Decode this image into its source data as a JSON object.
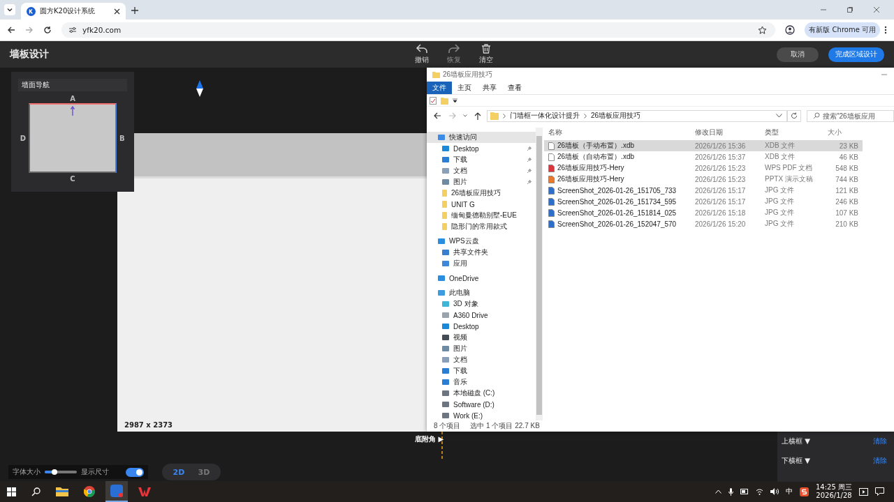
{
  "browser": {
    "tab": {
      "title": "圆方K20设计系统"
    },
    "url": "yfk20.com",
    "update_button": "有新版 Chrome 可用"
  },
  "app": {
    "title": "墙板设计",
    "toolbar": [
      {
        "label": "撤销",
        "kind": "undo",
        "disabled": false
      },
      {
        "label": "恢复",
        "kind": "redo",
        "disabled": true
      },
      {
        "label": "清空",
        "kind": "trash",
        "disabled": false
      }
    ],
    "buttons": [
      {
        "label": "取消",
        "kind": "secondary"
      },
      {
        "label": "完成区域设计",
        "kind": "primary"
      }
    ],
    "wall_nav": {
      "title": "墙面导航",
      "side_a": "A",
      "side_b": "B",
      "side_c": "C",
      "side_d": "D"
    },
    "canvas": {
      "dimensions": "2987 x 2373",
      "corner_label": "底附角 ▶"
    },
    "side_panel": [
      {
        "label": "上横框 ▼",
        "action": "清除"
      },
      {
        "label": "下横框 ▼",
        "action": "清除"
      }
    ],
    "font_size": {
      "label": "字体大小",
      "level": 0.3
    },
    "show_dimensions": {
      "label": "显示尺寸",
      "on": true
    },
    "view_modes": [
      {
        "label": "2D",
        "selected": true
      },
      {
        "label": "3D",
        "selected": false
      }
    ]
  },
  "explorer": {
    "title": "26墙板应用技巧",
    "ribbon_tabs": [
      {
        "label": "文件",
        "selected": true
      },
      {
        "label": "主页",
        "selected": false
      },
      {
        "label": "共享",
        "selected": false
      },
      {
        "label": "查看",
        "selected": false
      }
    ],
    "path": [
      "门墙框一体化设计提升",
      "26墙板应用技巧"
    ],
    "search": {
      "placeholder": "搜索\"26墙板应用"
    },
    "tree": [
      {
        "label": "快速访问",
        "kind": "star",
        "selected": true,
        "children": [
          {
            "label": "Desktop",
            "kind": "desktop",
            "selected": false,
            "pinned": true
          },
          {
            "label": "下载",
            "kind": "download",
            "selected": false,
            "pinned": true
          },
          {
            "label": "文档",
            "kind": "document",
            "selected": false,
            "pinned": true
          },
          {
            "label": "图片",
            "kind": "pictures",
            "selected": false,
            "pinned": true
          },
          {
            "label": "26墙板应用技巧",
            "kind": "folder",
            "selected": false,
            "pinned": false
          },
          {
            "label": "UNIT G",
            "kind": "folder",
            "selected": false,
            "pinned": false
          },
          {
            "label": "缅甸曼德勒别墅-EUE",
            "kind": "folder",
            "selected": false,
            "pinned": false
          },
          {
            "label": "隐形门的常用款式",
            "kind": "folder",
            "selected": false,
            "pinned": false
          }
        ]
      },
      {
        "label": "WPS云盘",
        "kind": "cloud",
        "selected": false,
        "children": [
          {
            "label": "共享文件夹",
            "kind": "share",
            "selected": false,
            "pinned": false
          },
          {
            "label": "应用",
            "kind": "apps",
            "selected": false,
            "pinned": false
          }
        ]
      },
      {
        "label": "OneDrive",
        "kind": "cloud",
        "selected": false
      },
      {
        "label": "此电脑",
        "kind": "pc",
        "selected": false,
        "children": [
          {
            "label": "3D 对象",
            "kind": "cube",
            "selected": false,
            "pinned": false
          },
          {
            "label": "A360 Drive",
            "kind": "drive",
            "selected": false,
            "pinned": false
          },
          {
            "label": "Desktop",
            "kind": "desktop",
            "selected": false,
            "pinned": false
          },
          {
            "label": "视频",
            "kind": "video",
            "selected": false,
            "pinned": false
          },
          {
            "label": "图片",
            "kind": "pictures",
            "selected": false,
            "pinned": false
          },
          {
            "label": "文档",
            "kind": "document",
            "selected": false,
            "pinned": false
          },
          {
            "label": "下载",
            "kind": "download",
            "selected": false,
            "pinned": false
          },
          {
            "label": "音乐",
            "kind": "music",
            "selected": false,
            "pinned": false
          },
          {
            "label": "本地磁盘 (C:)",
            "kind": "disk",
            "selected": false,
            "pinned": false
          },
          {
            "label": "Software (D:)",
            "kind": "disk",
            "selected": false,
            "pinned": false
          },
          {
            "label": "Work (E:)",
            "kind": "disk",
            "selected": false,
            "pinned": false
          }
        ]
      }
    ],
    "columns": [
      "名称",
      "修改日期",
      "类型",
      "大小"
    ],
    "files": [
      {
        "name": "26墙板（手动布置）.xdb",
        "date": "2026/1/26 15:36",
        "type": "XDB 文件",
        "size": "23 KB",
        "kind": "xdb",
        "selected": true
      },
      {
        "name": "26墙板（自动布置）.xdb",
        "date": "2026/1/26 15:37",
        "type": "XDB 文件",
        "size": "46 KB",
        "kind": "xdb",
        "selected": false
      },
      {
        "name": "26墙板应用技巧-Hery",
        "date": "2026/1/26 15:23",
        "type": "WPS PDF 文档",
        "size": "548 KB",
        "kind": "pdf",
        "selected": false
      },
      {
        "name": "26墙板应用技巧-Hery",
        "date": "2026/1/26 15:23",
        "type": "PPTX 演示文稿",
        "size": "744 KB",
        "kind": "pptx",
        "selected": false
      },
      {
        "name": "ScreenShot_2026-01-26_151705_733",
        "date": "2026/1/26 15:17",
        "type": "JPG 文件",
        "size": "121 KB",
        "kind": "jpg",
        "selected": false
      },
      {
        "name": "ScreenShot_2026-01-26_151734_595",
        "date": "2026/1/26 15:17",
        "type": "JPG 文件",
        "size": "246 KB",
        "kind": "jpg",
        "selected": false
      },
      {
        "name": "ScreenShot_2026-01-26_151814_025",
        "date": "2026/1/26 15:18",
        "type": "JPG 文件",
        "size": "107 KB",
        "kind": "jpg",
        "selected": false
      },
      {
        "name": "ScreenShot_2026-01-26_152047_570",
        "date": "2026/1/26 15:20",
        "type": "JPG 文件",
        "size": "210 KB",
        "kind": "jpg",
        "selected": false
      }
    ],
    "status": {
      "count": "8 个项目",
      "selection": "选中 1 个项目  22.7 KB"
    }
  },
  "taskbar": {
    "ime": "中",
    "time": "14:25 周三",
    "date": "2026/1/28"
  }
}
